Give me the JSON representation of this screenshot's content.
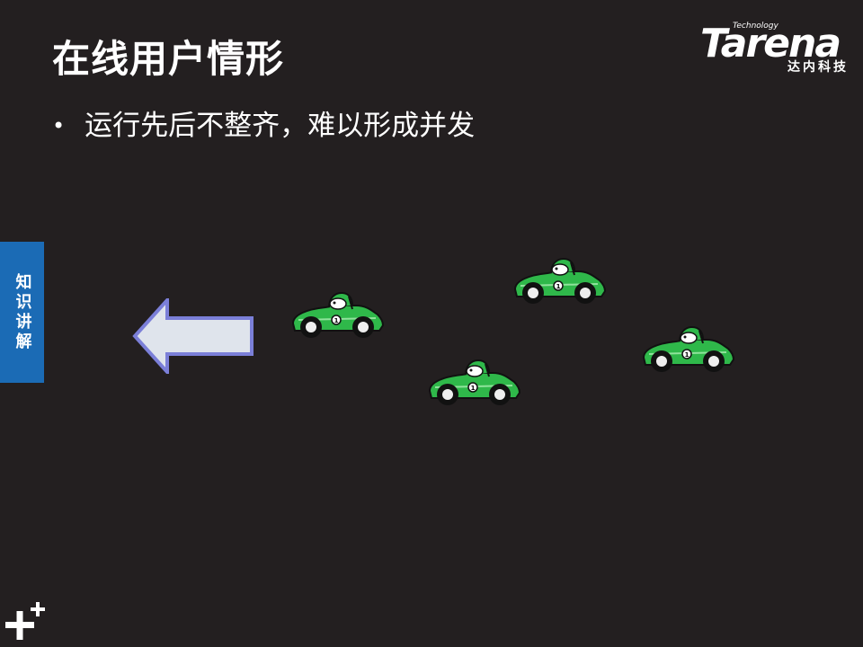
{
  "slide": {
    "title": "在线用户情形",
    "bullets": [
      "运行先后不整齐，难以形成并发"
    ]
  },
  "logo": {
    "tech": "Technology",
    "word": "Tarena",
    "cn": "达内科技"
  },
  "side_tab": {
    "label": "知识讲解"
  },
  "cars": [
    {
      "number": "1"
    },
    {
      "number": "1"
    },
    {
      "number": "1"
    },
    {
      "number": "1"
    }
  ],
  "colors": {
    "background": "#231f20",
    "side_tab": "#1b6bb5",
    "car_body": "#2fb84a",
    "arrow_fill": "#dfe4ec",
    "arrow_border": "#7b7fd8"
  },
  "icons": [
    "left-arrow-icon",
    "race-car-icon",
    "plus-icon"
  ]
}
